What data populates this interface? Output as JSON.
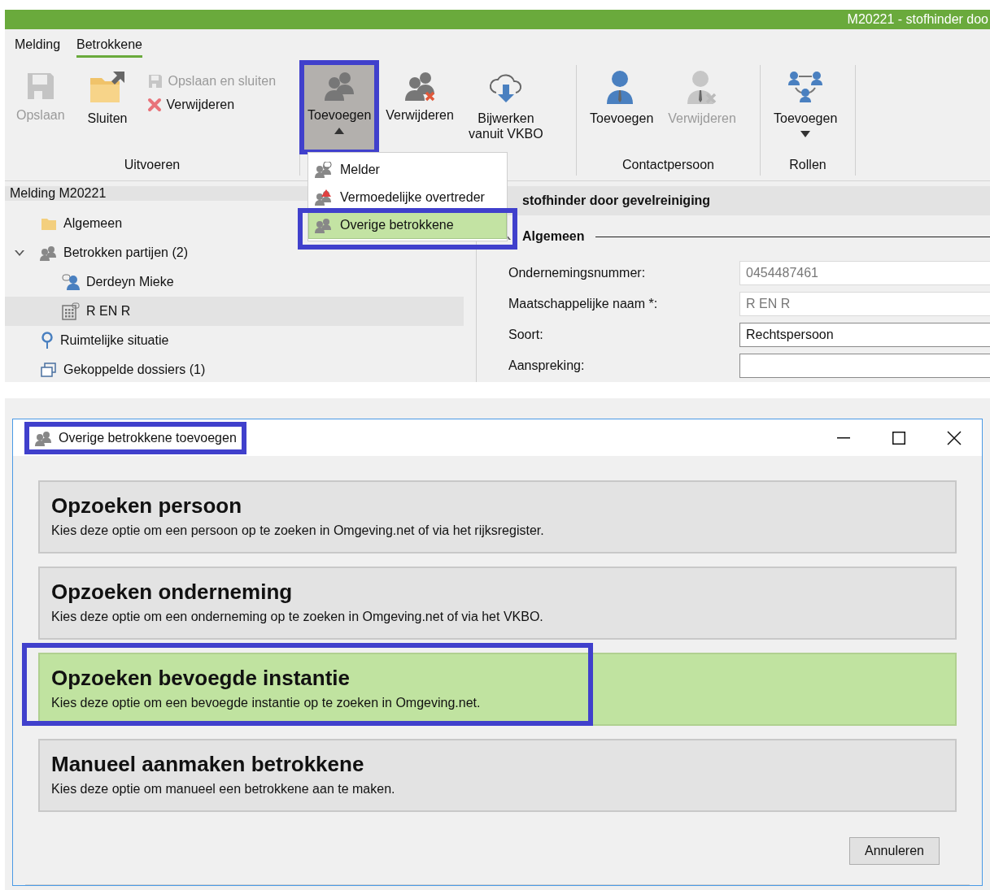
{
  "app": {
    "title": "M20221 - stofhinder doo"
  },
  "ribbon": {
    "tabs": [
      {
        "label": "Melding",
        "selected": false
      },
      {
        "label": "Betrokkene",
        "selected": true
      }
    ],
    "groups": [
      {
        "label": "Uitvoeren",
        "buttons": [
          {
            "kind": "large",
            "label": "Opslaan",
            "disabled": true
          },
          {
            "kind": "large",
            "label": "Sluiten",
            "disabled": false
          },
          {
            "kind": "small",
            "label": "Opslaan en sluiten",
            "disabled": true
          },
          {
            "kind": "small",
            "label": "Verwijderen",
            "disabled": false
          }
        ]
      },
      {
        "buttons": [
          {
            "kind": "large",
            "label": "Toevoegen",
            "disabled": false,
            "pressed": true,
            "highlighted": true,
            "dropdown": true,
            "menu_open": true
          },
          {
            "kind": "large",
            "label": "Verwijderen",
            "disabled": false
          },
          {
            "kind": "large",
            "label": "Bijwerken vanuit VKBO",
            "disabled": false
          }
        ]
      },
      {
        "label": "Contactpersoon",
        "buttons": [
          {
            "kind": "large",
            "label": "Toevoegen",
            "disabled": false
          },
          {
            "kind": "large",
            "label": "Verwijderen",
            "disabled": true
          }
        ]
      },
      {
        "label": "Rollen",
        "buttons": [
          {
            "kind": "large",
            "label": "Toevoegen",
            "disabled": false,
            "dropdown": true
          }
        ]
      }
    ]
  },
  "menu": {
    "items": [
      {
        "label": "Melder",
        "selected": false
      },
      {
        "label": "Vermoedelijke overtreder",
        "selected": false
      },
      {
        "label": "Overige betrokkene",
        "selected": true,
        "highlighted": true
      }
    ]
  },
  "navigation": {
    "header": "Melding M20221",
    "items": [
      {
        "label": "Algemeen",
        "selected": false
      },
      {
        "label": "Betrokken partijen (2)",
        "selected": false,
        "expanded": true,
        "children": [
          {
            "label": "Derdeyn Mieke",
            "selected": false
          },
          {
            "label": "R EN R",
            "selected": true
          }
        ]
      },
      {
        "label": "Ruimtelijke situatie",
        "selected": false
      },
      {
        "label": "Gekoppelde dossiers (1)",
        "selected": false
      }
    ]
  },
  "detail": {
    "header": "stofhinder door gevelreiniging",
    "section": {
      "title": "Algemeen",
      "expanded": true
    },
    "fields": [
      {
        "label": "Ondernemingsnummer:",
        "value": "0454487461",
        "disabled": true
      },
      {
        "label": "Maatschappelijke naam *:",
        "value": "R EN R",
        "disabled": true
      },
      {
        "label": "Soort:",
        "value": "Rechtspersoon",
        "disabled": false
      },
      {
        "label": "Aanspreking:",
        "disabled": false
      }
    ]
  },
  "dialog": {
    "title": "Overige betrokkene toevoegen",
    "highlighted": true,
    "options": [
      {
        "title": "Opzoeken persoon",
        "description": "Kies deze optie om een persoon op te zoeken in Omgeving.net of via het rijksregister.",
        "selected": false
      },
      {
        "title": "Opzoeken onderneming",
        "description": "Kies deze optie om een onderneming op te zoeken in Omgeving.net of via het VKBO.",
        "selected": false
      },
      {
        "title": "Opzoeken bevoegde instantie",
        "description": "Kies deze optie om een bevoegde instantie op te zoeken in Omgeving.net.",
        "selected": true,
        "highlighted": true
      },
      {
        "title": "Manueel aanmaken betrokkene",
        "description": "Kies deze optie om manueel een betrokkene aan te maken.",
        "selected": false
      }
    ],
    "cancel_button": "Annuleren"
  }
}
